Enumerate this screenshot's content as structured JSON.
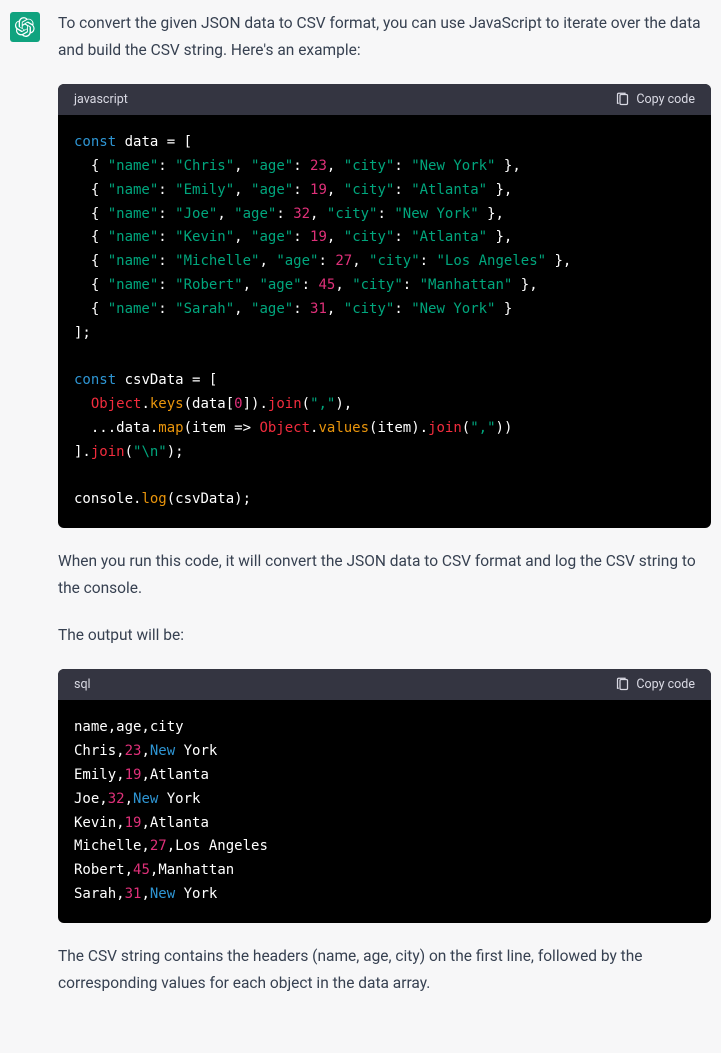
{
  "avatar_alt": "ChatGPT",
  "intro_text": "To convert the given JSON data to CSV format, you can use JavaScript to iterate over the data and build the CSV string. Here's an example:",
  "mid_text_1": "When you run this code, it will convert the JSON data to CSV format and log the CSV string to the console.",
  "mid_text_2": "The output will be:",
  "outro_text": "The CSV string contains the headers (name, age, city) on the first line, followed by the corresponding values for each object in the data array.",
  "copy_label": "Copy code",
  "block1": {
    "lang": "javascript",
    "records": [
      {
        "name": "Chris",
        "age": 23,
        "city": "New York"
      },
      {
        "name": "Emily",
        "age": 19,
        "city": "Atlanta"
      },
      {
        "name": "Joe",
        "age": 32,
        "city": "New York"
      },
      {
        "name": "Kevin",
        "age": 19,
        "city": "Atlanta"
      },
      {
        "name": "Michelle",
        "age": 27,
        "city": "Los Angeles"
      },
      {
        "name": "Robert",
        "age": 45,
        "city": "Manhattan"
      },
      {
        "name": "Sarah",
        "age": 31,
        "city": "New York"
      }
    ]
  },
  "block2": {
    "lang": "sql",
    "csv_header": "name,age,city",
    "rows": [
      {
        "name": "Chris",
        "age": 23,
        "city": "New York"
      },
      {
        "name": "Emily",
        "age": 19,
        "city": "Atlanta"
      },
      {
        "name": "Joe",
        "age": 32,
        "city": "New York"
      },
      {
        "name": "Kevin",
        "age": 19,
        "city": "Atlanta"
      },
      {
        "name": "Michelle",
        "age": 27,
        "city": "Los Angeles"
      },
      {
        "name": "Robert",
        "age": 45,
        "city": "Manhattan"
      },
      {
        "name": "Sarah",
        "age": 31,
        "city": "New York"
      }
    ]
  }
}
